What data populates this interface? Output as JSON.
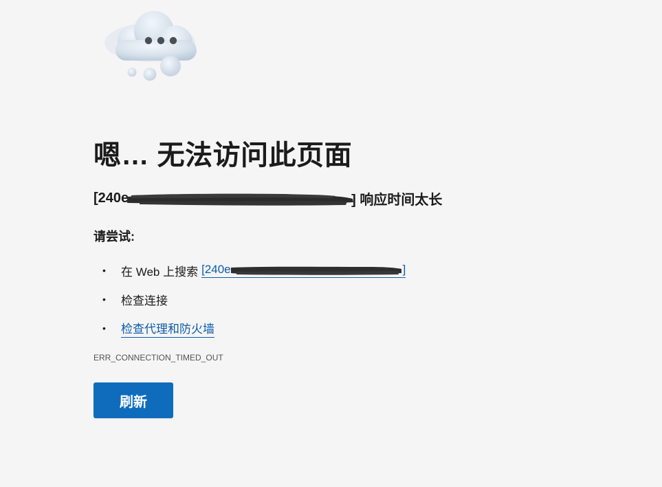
{
  "icons": {
    "error_illustration": "cloud-ellipsis-icon"
  },
  "error": {
    "title": "嗯… 无法访问此页面",
    "host": "[240e",
    "host_suffix": "] 响应时间太长",
    "try_heading": "请尝试:",
    "suggestions": [
      {
        "prefix": "在 Web 上搜索 ",
        "link_text": "[240e",
        "link_suffix": "]"
      },
      {
        "text": "检查连接"
      },
      {
        "link_text": "检查代理和防火墙"
      }
    ],
    "code": "ERR_CONNECTION_TIMED_OUT",
    "refresh_label": "刷新"
  },
  "colors": {
    "background": "#f5f5f6",
    "link": "#0e5ca8",
    "button": "#0f6cbd"
  }
}
